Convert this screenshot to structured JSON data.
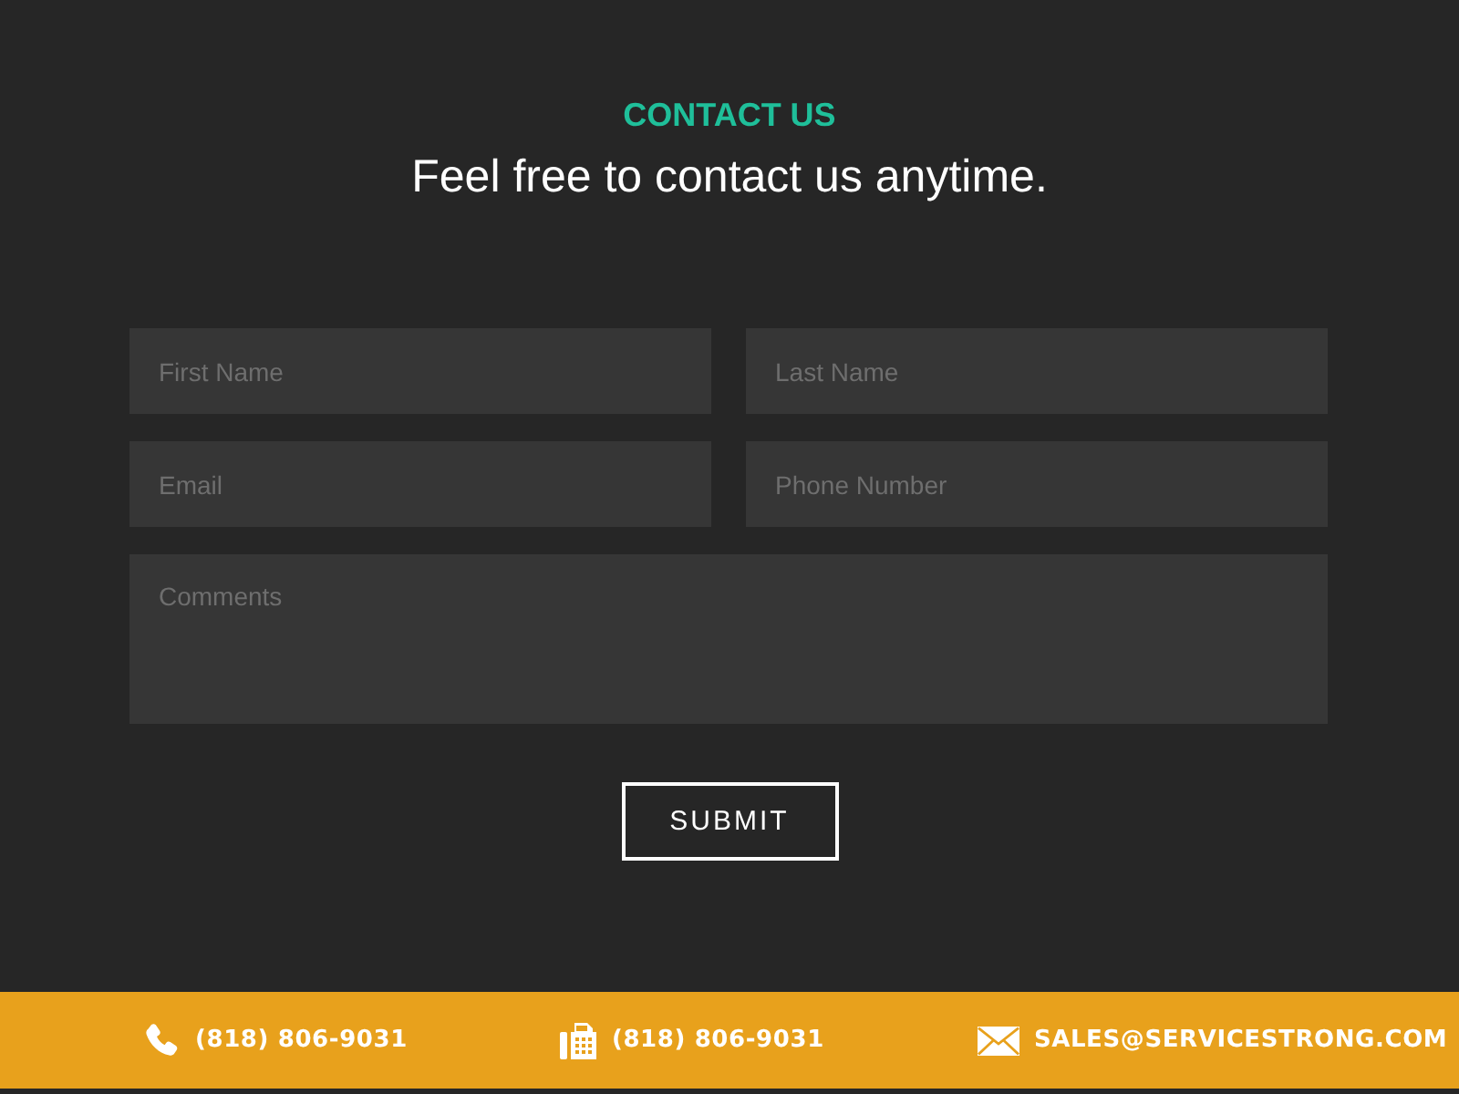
{
  "header": {
    "eyebrow": "CONTACT US",
    "title": "Feel free to contact us anytime."
  },
  "form": {
    "fields": [
      {
        "kind": "input",
        "placeholder": "First Name"
      },
      {
        "kind": "input",
        "placeholder": "Last Name"
      },
      {
        "kind": "input",
        "placeholder": "Email"
      },
      {
        "kind": "input",
        "placeholder": "Phone Number"
      },
      {
        "kind": "textarea",
        "placeholder": "Comments"
      }
    ],
    "submit": "SUBMIT"
  },
  "footer": {
    "items": [
      {
        "kind": "phone",
        "text": "(818) 806-9031"
      },
      {
        "kind": "fax",
        "text": "(818) 806-9031"
      },
      {
        "kind": "email",
        "text": "SALES@SERVICESTRONG.COM"
      }
    ]
  }
}
